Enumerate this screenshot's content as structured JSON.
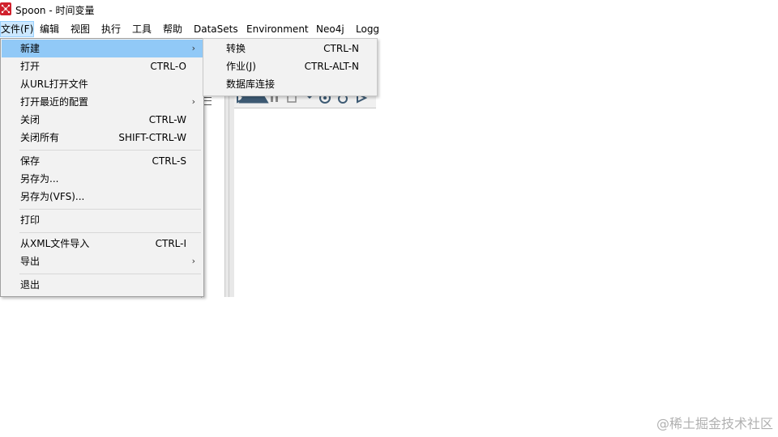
{
  "window": {
    "title": "Spoon - 时间变量"
  },
  "menubar": {
    "items": [
      {
        "label": "文件(F)"
      },
      {
        "label": "编辑"
      },
      {
        "label": "视图"
      },
      {
        "label": "执行"
      },
      {
        "label": "工具"
      },
      {
        "label": "帮助"
      },
      {
        "label": "DataSets"
      },
      {
        "label": "Environment"
      },
      {
        "label": "Neo4j"
      },
      {
        "label": "Logg"
      }
    ]
  },
  "file_menu": {
    "items": [
      {
        "label": "新建",
        "shortcut": "",
        "submenu": true,
        "highlighted": true
      },
      {
        "label": "打开",
        "shortcut": "CTRL-O"
      },
      {
        "label": "从URL打开文件",
        "shortcut": ""
      },
      {
        "label": "打开最近的配置",
        "shortcut": "",
        "submenu": true
      },
      {
        "label": "关闭",
        "shortcut": "CTRL-W"
      },
      {
        "label": "关闭所有",
        "shortcut": "SHIFT-CTRL-W"
      },
      {
        "label": "保存",
        "shortcut": "CTRL-S"
      },
      {
        "label": "另存为...",
        "shortcut": ""
      },
      {
        "label": "另存为(VFS)...",
        "shortcut": ""
      },
      {
        "label": "打印",
        "shortcut": ""
      },
      {
        "label": "从XML文件导入",
        "shortcut": "CTRL-I"
      },
      {
        "label": "导出",
        "shortcut": "",
        "submenu": true
      },
      {
        "label": "退出",
        "shortcut": ""
      }
    ]
  },
  "new_submenu": {
    "items": [
      {
        "label": "转换",
        "shortcut": "CTRL-N"
      },
      {
        "label": "作业(J)",
        "shortcut": "CTRL-ALT-N"
      },
      {
        "label": "数据库连接",
        "shortcut": ""
      }
    ]
  },
  "watermark": "@稀土掘金技术社区",
  "icons": {
    "app": "spoon-logo-icon",
    "canvas": "beaker-icon",
    "submenu_arrow": "chevron-right-icon",
    "arrow_glyph": "›"
  },
  "colors": {
    "menu_highlight": "#91c9f7",
    "menubar_active": "#cce8ff",
    "app_icon": "#d0202c",
    "beaker": "#3d5a73"
  }
}
